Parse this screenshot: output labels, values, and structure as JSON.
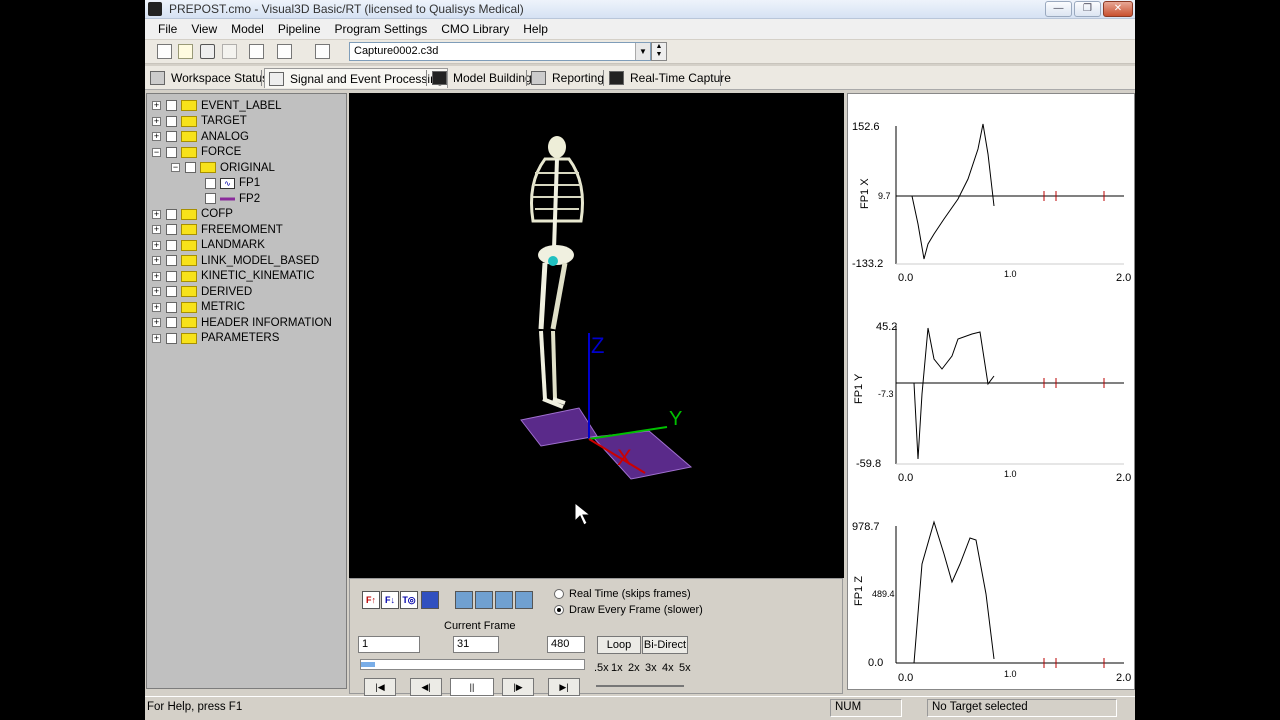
{
  "window": {
    "title": "PREPOST.cmo - Visual3D Basic/RT (licensed to Qualisys Medical)",
    "min": "—",
    "max": "❐",
    "close": "✕"
  },
  "menu": [
    "File",
    "View",
    "Model",
    "Pipeline",
    "Program Settings",
    "CMO Library",
    "Help"
  ],
  "toolbar": {
    "capture_file": "Capture0002.c3d"
  },
  "tabs": [
    "Workspace Status",
    "Signal and Event Processing",
    "Model Building",
    "Reporting",
    "Real-Time Capture"
  ],
  "tree": {
    "top": [
      "EVENT_LABEL",
      "TARGET",
      "ANALOG",
      "FORCE"
    ],
    "force_child": "ORIGINAL",
    "original_children": [
      "FP1",
      "FP2"
    ],
    "rest": [
      "COFP",
      "FREEMOMENT",
      "LANDMARK",
      "LINK_MODEL_BASED",
      "KINETIC_KINEMATIC",
      "DERIVED",
      "METRIC",
      "HEADER INFORMATION",
      "PARAMETERS"
    ]
  },
  "viewport": {
    "axis_y": "Y",
    "axis_z": "Z",
    "axis_x": "X",
    "colors": {
      "plate": "#5a2a8a",
      "axis_green": "#00c000",
      "axis_blue": "#0000cc",
      "axis_red": "#cc0000"
    }
  },
  "playback": {
    "realtime_label": "Real Time (skips frames)",
    "draw_every_label": "Draw Every Frame (slower)",
    "mode": "draw_every",
    "current_frame_label": "Current Frame",
    "start_frame": "1",
    "current_frame": "31",
    "end_frame": "480",
    "loop": "Loop",
    "bidirect": "Bi-Direct",
    "speeds": [
      ".5x",
      "1x",
      "2x",
      "3x",
      "4x",
      "5x"
    ],
    "progress": 0.065,
    "tool_f1": "F↑",
    "tool_f2": "F↓",
    "tool_t": "T◎",
    "buttons": [
      "|◀",
      "◀|",
      "||",
      "|▶",
      "▶|"
    ]
  },
  "graphs": [
    {
      "ylabel": "FP1 X",
      "ymax": "152.6",
      "ymid": "9.7",
      "ymin": "-133.2",
      "xticks": [
        "0.0",
        "1.0",
        "2.0"
      ]
    },
    {
      "ylabel": "FP1 Y",
      "ymax": "45.2",
      "ymid": "-7.3",
      "ymin": "-59.8",
      "xticks": [
        "0.0",
        "1.0",
        "2.0"
      ]
    },
    {
      "ylabel": "FP1 Z",
      "ymax": "978.7",
      "ymid": "489.4",
      "ymin": "0.0",
      "xticks": [
        "0.0",
        "1.0",
        "2.0"
      ]
    }
  ],
  "status": {
    "help": "For Help, press F1",
    "num": "NUM",
    "target": "No Target selected"
  }
}
